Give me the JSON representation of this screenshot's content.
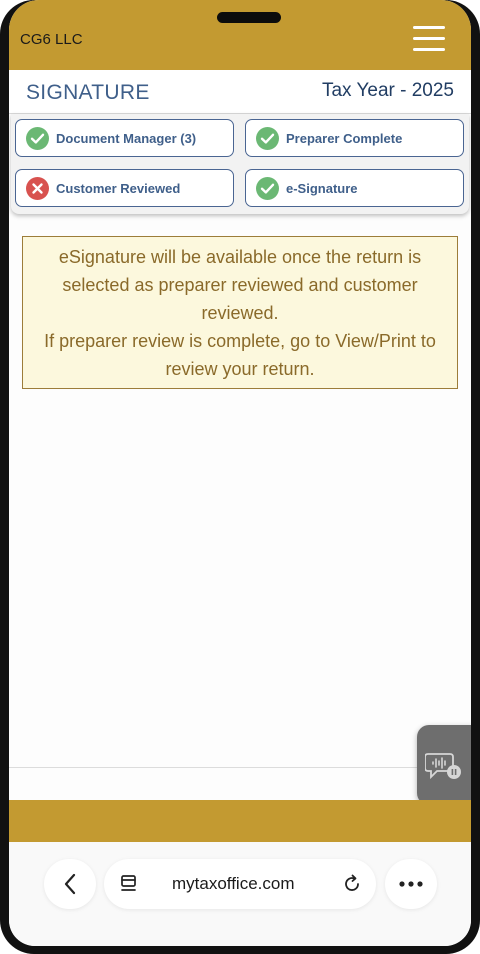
{
  "header": {
    "brand": "CG6 LLC"
  },
  "title_row": {
    "title": "SIGNATURE",
    "tax_year": "Tax Year - 2025"
  },
  "status_items": [
    {
      "label": "Document Manager (3)",
      "state": "complete",
      "icon": "check-circle-icon"
    },
    {
      "label": "Preparer Complete",
      "state": "complete",
      "icon": "check-circle-icon"
    },
    {
      "label": "Customer Reviewed",
      "state": "incomplete",
      "icon": "x-circle-icon"
    },
    {
      "label": "e-Signature",
      "state": "complete",
      "icon": "check-circle-icon"
    }
  ],
  "notice": {
    "line1": "eSignature will be available once the return is selected as preparer reviewed and customer reviewed.",
    "line2": "If preparer review is complete, go to View/Print to review your return."
  },
  "browser": {
    "url": "mytaxoffice.com"
  },
  "colors": {
    "brand_gold": "#c39a31",
    "title_blue": "#3f5f8a",
    "success_green": "#6bb874",
    "error_red": "#d8524f",
    "notice_bg": "#fcf8dd",
    "notice_text": "#8a6a2a"
  }
}
